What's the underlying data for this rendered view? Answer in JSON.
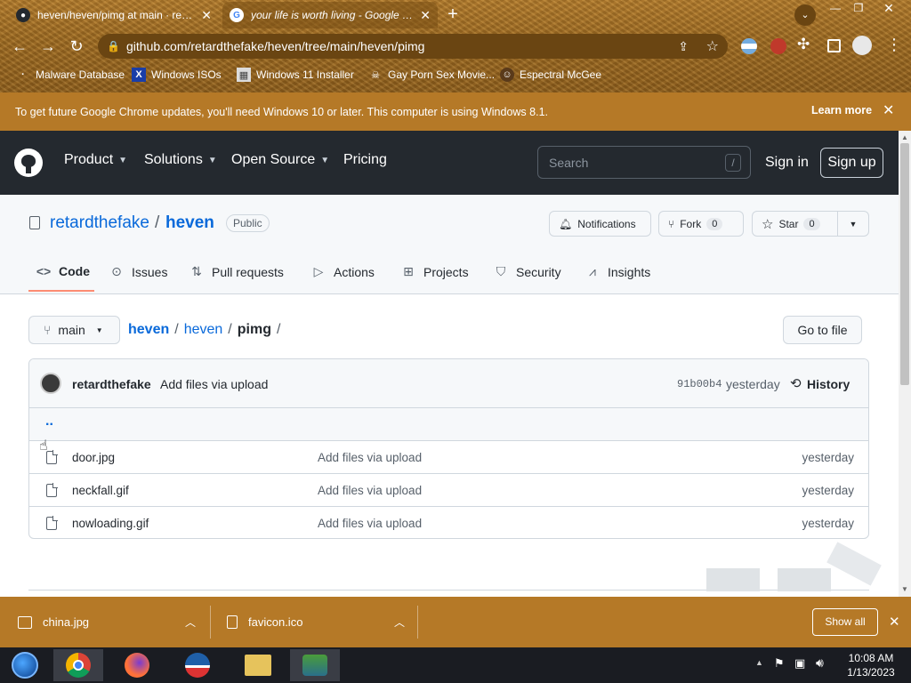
{
  "browser": {
    "tabs": [
      {
        "title": "heven/heven/pimg at main · retardthefake",
        "icon": "github-icon"
      },
      {
        "title": "your life is worth living - Google Search",
        "icon": "google-icon"
      }
    ],
    "new_tab": "+",
    "url": "github.com/retardthefake/heven/tree/main/heven/pimg",
    "bookmarks": [
      {
        "label": "Malware Database",
        "icon": "m-icon"
      },
      {
        "label": "Windows ISOs",
        "icon": "x-icon"
      },
      {
        "label": "Windows 11 Installer",
        "icon": "image-icon"
      },
      {
        "label": "Gay Porn Sex Movie...",
        "icon": "skull-icon"
      },
      {
        "label": "Espectral McGee",
        "icon": "avatar-icon"
      }
    ],
    "infobar": {
      "message": "To get future Google Chrome updates, you'll need Windows 10 or later. This computer is using Windows 8.1.",
      "learn_more": "Learn more"
    }
  },
  "github": {
    "nav": [
      "Product",
      "Solutions",
      "Open Source",
      "Pricing"
    ],
    "search_placeholder": "Search",
    "search_key": "/",
    "sign_in": "Sign in",
    "sign_up": "Sign up",
    "repo": {
      "owner": "retardthefake",
      "separator": "/",
      "name": "heven",
      "visibility": "Public",
      "notifications": "Notifications",
      "fork": "Fork",
      "fork_count": "0",
      "star": "Star",
      "star_count": "0"
    },
    "tabs": [
      "Code",
      "Issues",
      "Pull requests",
      "Actions",
      "Projects",
      "Security",
      "Insights"
    ],
    "branch": "main",
    "breadcrumb": {
      "root": "heven",
      "mid": "heven",
      "current": "pimg",
      "sep": "/"
    },
    "go_to_file": "Go to file",
    "commit": {
      "author": "retardthefake",
      "message": "Add files via upload",
      "hash": "91b00b4",
      "time": "yesterday",
      "history": "History"
    },
    "parent_dir": "..",
    "files": [
      {
        "name": "door.jpg",
        "message": "Add files via upload",
        "time": "yesterday"
      },
      {
        "name": "neckfall.gif",
        "message": "Add files via upload",
        "time": "yesterday"
      },
      {
        "name": "nowloading.gif",
        "message": "Add files via upload",
        "time": "yesterday"
      }
    ]
  },
  "downloads": {
    "items": [
      {
        "name": "china.jpg"
      },
      {
        "name": "favicon.ico"
      }
    ],
    "show_all": "Show all"
  },
  "taskbar": {
    "time": "10:08 AM",
    "date": "1/13/2023"
  },
  "colors": {
    "link": "#0969da",
    "header": "#24292f",
    "chrome_accent": "#b57927"
  }
}
